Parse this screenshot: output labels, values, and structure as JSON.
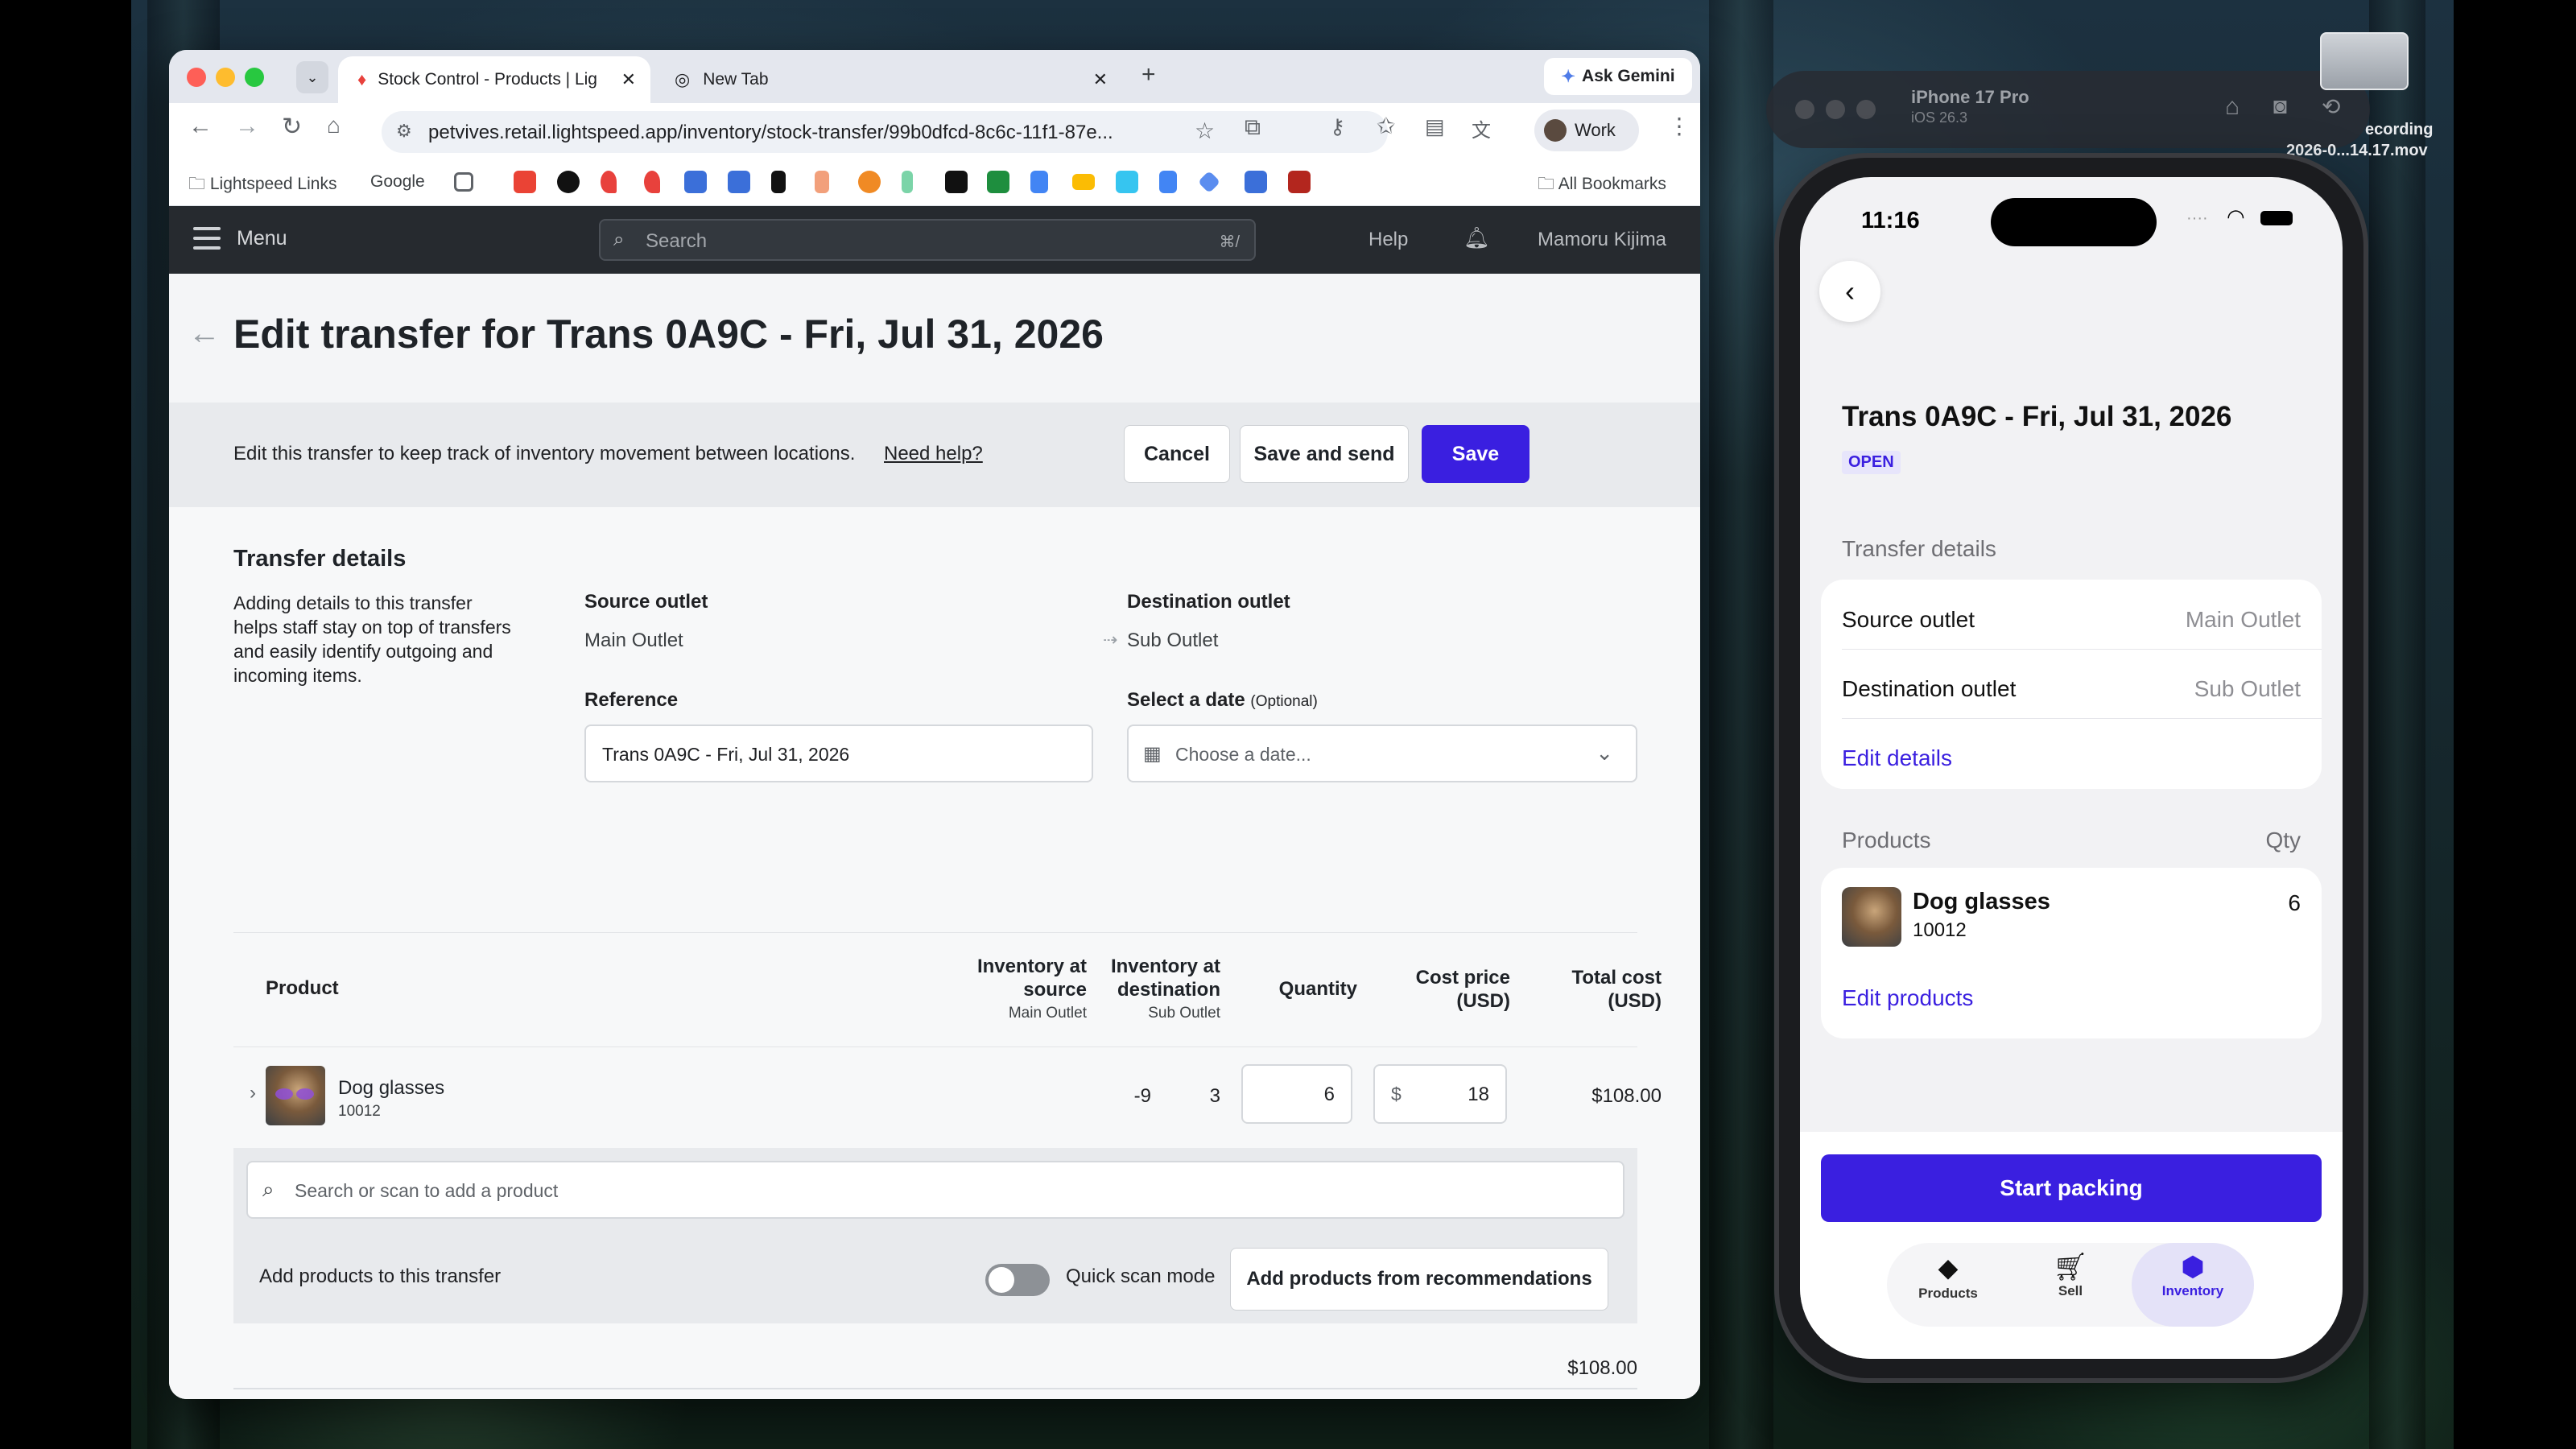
{
  "browser": {
    "tabs": [
      {
        "title": "Stock Control - Products | Lig"
      },
      {
        "title": "New Tab"
      }
    ],
    "ask_gemini": "Ask Gemini",
    "url": "petvives.retail.lightspeed.app/inventory/stock-transfer/99b0dfcd-8c6c-11f1-87e...",
    "profile": "Work",
    "bookmarks": {
      "lightspeed": "Lightspeed Links",
      "google": "Google",
      "all": "All Bookmarks"
    }
  },
  "app_nav": {
    "menu": "Menu",
    "search_placeholder": "Search",
    "search_shortcut": "⌘/",
    "help": "Help",
    "user": "Mamoru Kijima"
  },
  "page": {
    "title": "Edit transfer for Trans 0A9C - Fri, Jul 31, 2026",
    "info_text": "Edit this transfer to keep track of inventory movement between locations.",
    "need_help": "Need help?",
    "cancel": "Cancel",
    "save_and_send": "Save and send",
    "save": "Save"
  },
  "details": {
    "heading": "Transfer details",
    "description": [
      "Adding details to this transfer",
      "helps staff stay on top of transfers",
      "and easily identify outgoing and",
      "incoming items."
    ],
    "source_label": "Source outlet",
    "source_value": "Main Outlet",
    "dest_label": "Destination outlet",
    "dest_value": "Sub Outlet",
    "reference_label": "Reference",
    "reference_value": "Trans 0A9C - Fri, Jul 31, 2026",
    "date_label": "Select a date",
    "date_optional": "(Optional)",
    "date_placeholder": "Choose a date..."
  },
  "table": {
    "headers": {
      "product": "Product",
      "inv_source": [
        "Inventory at",
        "source"
      ],
      "inv_source_sub": "Main Outlet",
      "inv_dest": [
        "Inventory at",
        "destination"
      ],
      "inv_dest_sub": "Sub Outlet",
      "quantity": "Quantity",
      "cost": [
        "Cost price",
        "(USD)"
      ],
      "total": [
        "Total cost",
        "(USD)"
      ]
    },
    "rows": [
      {
        "name": "Dog glasses",
        "sku": "10012",
        "inv_source": "-9",
        "inv_dest": "3",
        "quantity": "6",
        "currency": "$",
        "cost": "18",
        "total": "$108.00"
      }
    ],
    "search_placeholder": "Search or scan to add a product",
    "add_products_text": "Add products to this transfer",
    "quick_scan": "Quick scan mode",
    "add_recommendations": "Add products from recommendations",
    "grand_total": "$108.00"
  },
  "simulator": {
    "device": "iPhone 17 Pro",
    "os": "iOS 26.3",
    "recording_label": "ecording",
    "recording_name": "2026-0...14.17.mov"
  },
  "phone": {
    "time": "11:16",
    "title": "Trans 0A9C - Fri, Jul 31, 2026",
    "status": "OPEN",
    "details_heading": "Transfer details",
    "source_label": "Source outlet",
    "source_value": "Main Outlet",
    "dest_label": "Destination outlet",
    "dest_value": "Sub Outlet",
    "edit_details": "Edit details",
    "products_heading": "Products",
    "qty_heading": "Qty",
    "product_name": "Dog glasses",
    "product_sku": "10012",
    "product_qty": "6",
    "edit_products": "Edit products",
    "start_packing": "Start packing",
    "tabs": [
      "Products",
      "Sell",
      "Inventory"
    ]
  },
  "colors": {
    "primary": "#3a1fe0",
    "nav_bg": "#262a2f",
    "danger_dot_red": "#fe5f57",
    "yellow": "#febc2e",
    "green": "#28c840"
  }
}
